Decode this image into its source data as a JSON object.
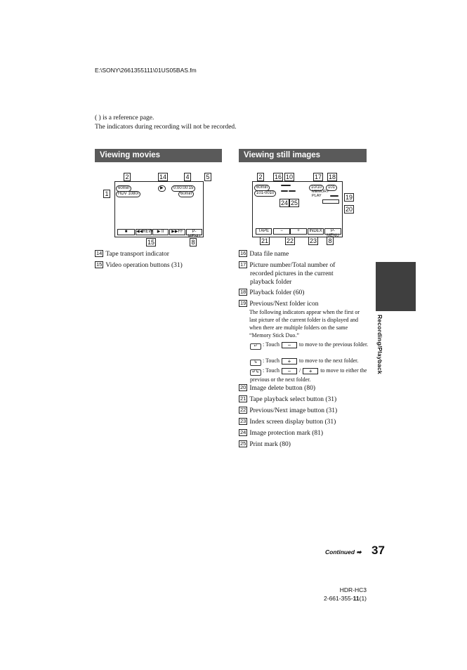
{
  "file_path": "E:\\SONY\\2661355111\\01US05BAS.fm",
  "intro": [
    "( ) is a reference page.",
    "The indicators during recording will not be recorded."
  ],
  "sections": {
    "movies": "Viewing movies",
    "stills": "Viewing still images"
  },
  "movie_screen": {
    "labels": {
      "n1": "1",
      "n2": "2",
      "n14": "14",
      "n4": "4",
      "n5": "5",
      "n15": "15",
      "n8": "8"
    },
    "battery": "60min",
    "format": "HDV 1080i",
    "tape_indicator": "▶",
    "timecode": "0:00:00:15",
    "remaining": "60min",
    "buttons": [
      "■",
      "◀◀REW",
      "▶ II",
      "▶▶FF",
      "P-MENU"
    ]
  },
  "still_screen": {
    "labels": {
      "n2": "2",
      "n16": "16",
      "n10": "10",
      "n17": "17",
      "n18": "18",
      "n19": "19",
      "n20": "20",
      "n24": "24",
      "n25": "25",
      "n21": "21",
      "n22": "22",
      "n23": "23",
      "n8": "8"
    },
    "battery": "60min",
    "file_name": "101-0010",
    "picture_count": "10/10",
    "folder": "101",
    "mode": "MEMORY PLAY",
    "buttons": [
      "TAPE",
      "−",
      "+",
      "INDEX",
      "P-MENU"
    ]
  },
  "left_list": [
    {
      "n": "14",
      "text": "Tape transport indicator"
    },
    {
      "n": "15",
      "text": "Video operation buttons (31)"
    }
  ],
  "right_list": [
    {
      "n": "16",
      "text": "Data file name"
    },
    {
      "n": "17",
      "text": "Picture number/Total number of recorded pictures in the current playback folder"
    },
    {
      "n": "18",
      "text": "Playback folder (60)"
    },
    {
      "n": "19",
      "text": "Previous/Next folder icon"
    }
  ],
  "folder_note": "The following indicators appear when the first or last picture of the current folder is displayed and when there are multiple folders on the same “Memory Stick Duo.”",
  "folder_rows": [
    {
      "pre": ": Touch",
      "btn": "−",
      "post": "to move to the previous folder."
    },
    {
      "pre": ": Touch",
      "btn": "+",
      "post": "to move to the next folder."
    },
    {
      "pre": ": Touch",
      "btn": "−",
      "btn2": "+",
      "post": "to move to either the previous or the next folder."
    }
  ],
  "right_list2": [
    {
      "n": "20",
      "text": "Image delete button (80)"
    },
    {
      "n": "21",
      "text": "Tape playback select button (31)"
    },
    {
      "n": "22",
      "text": "Previous/Next image button (31)"
    },
    {
      "n": "23",
      "text": "Index screen display button (31)"
    },
    {
      "n": "24",
      "text": "Image protection mark (81)"
    },
    {
      "n": "25",
      "text": "Print mark (80)"
    }
  ],
  "side_tab": "Recording/Playback",
  "continued": "Continued",
  "page_number": "37",
  "model": "HDR-HC3",
  "part_prefix": "2-661-355-",
  "part_bold": "11",
  "part_suffix": "(1)"
}
